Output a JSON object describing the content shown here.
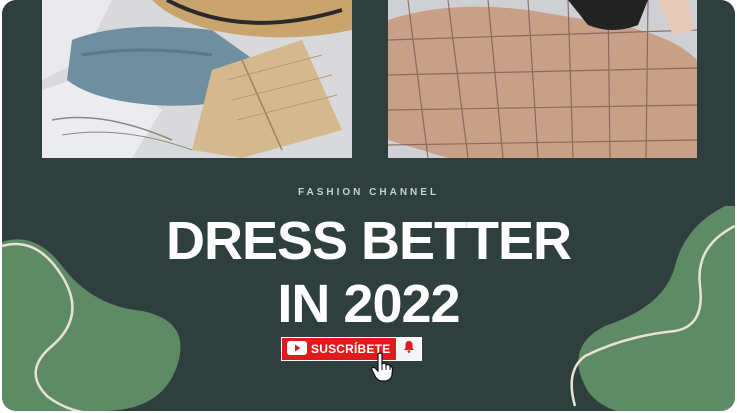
{
  "header": {
    "eyebrow": "FASHION CHANNEL"
  },
  "headline": {
    "line1": "DRESS BETTER",
    "line2": "IN 2022"
  },
  "subscribe": {
    "label": "SUSCRÍBETE",
    "icon": "youtube-play-icon",
    "bell_icon": "bell-icon"
  },
  "colors": {
    "background": "#2f3f3e",
    "blob": "#5e8a66",
    "blob_outline": "#e8e2d2",
    "subscribe_red": "#e11b1b",
    "text": "#ffffff",
    "eyebrow": "#c9d1cf"
  },
  "images": [
    {
      "name": "photo-hat-jeans-book",
      "description": "hat, jeans and open book on sheet"
    },
    {
      "name": "photo-plaid-jacket",
      "description": "person in plaid jacket"
    }
  ]
}
